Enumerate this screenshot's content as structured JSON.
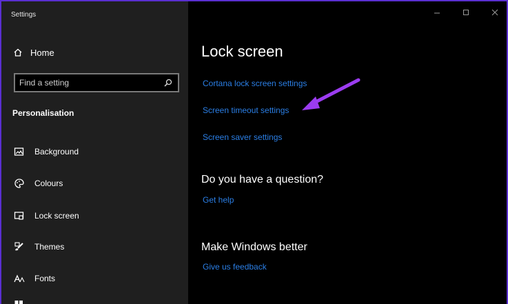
{
  "window": {
    "title": "Settings"
  },
  "sidebar": {
    "home_label": "Home",
    "search_placeholder": "Find a setting",
    "section_title": "Personalisation",
    "items": [
      {
        "label": "Background",
        "icon": "picture-icon"
      },
      {
        "label": "Colours",
        "icon": "palette-icon"
      },
      {
        "label": "Lock screen",
        "icon": "lock-screen-icon"
      },
      {
        "label": "Themes",
        "icon": "brush-icon"
      },
      {
        "label": "Fonts",
        "icon": "font-icon"
      }
    ]
  },
  "main": {
    "title": "Lock screen",
    "links": [
      {
        "label": "Cortana lock screen settings"
      },
      {
        "label": "Screen timeout settings"
      },
      {
        "label": "Screen saver settings"
      }
    ],
    "question": {
      "heading": "Do you have a question?",
      "link": "Get help"
    },
    "feedback": {
      "heading": "Make Windows better",
      "link": "Give us feedback"
    }
  },
  "colors": {
    "accent_link": "#2b7fe6",
    "annotation_arrow": "#9b3cf0",
    "sidebar_bg": "#1f1f1f",
    "main_bg": "#000000",
    "frame": "#5a2fd0"
  }
}
